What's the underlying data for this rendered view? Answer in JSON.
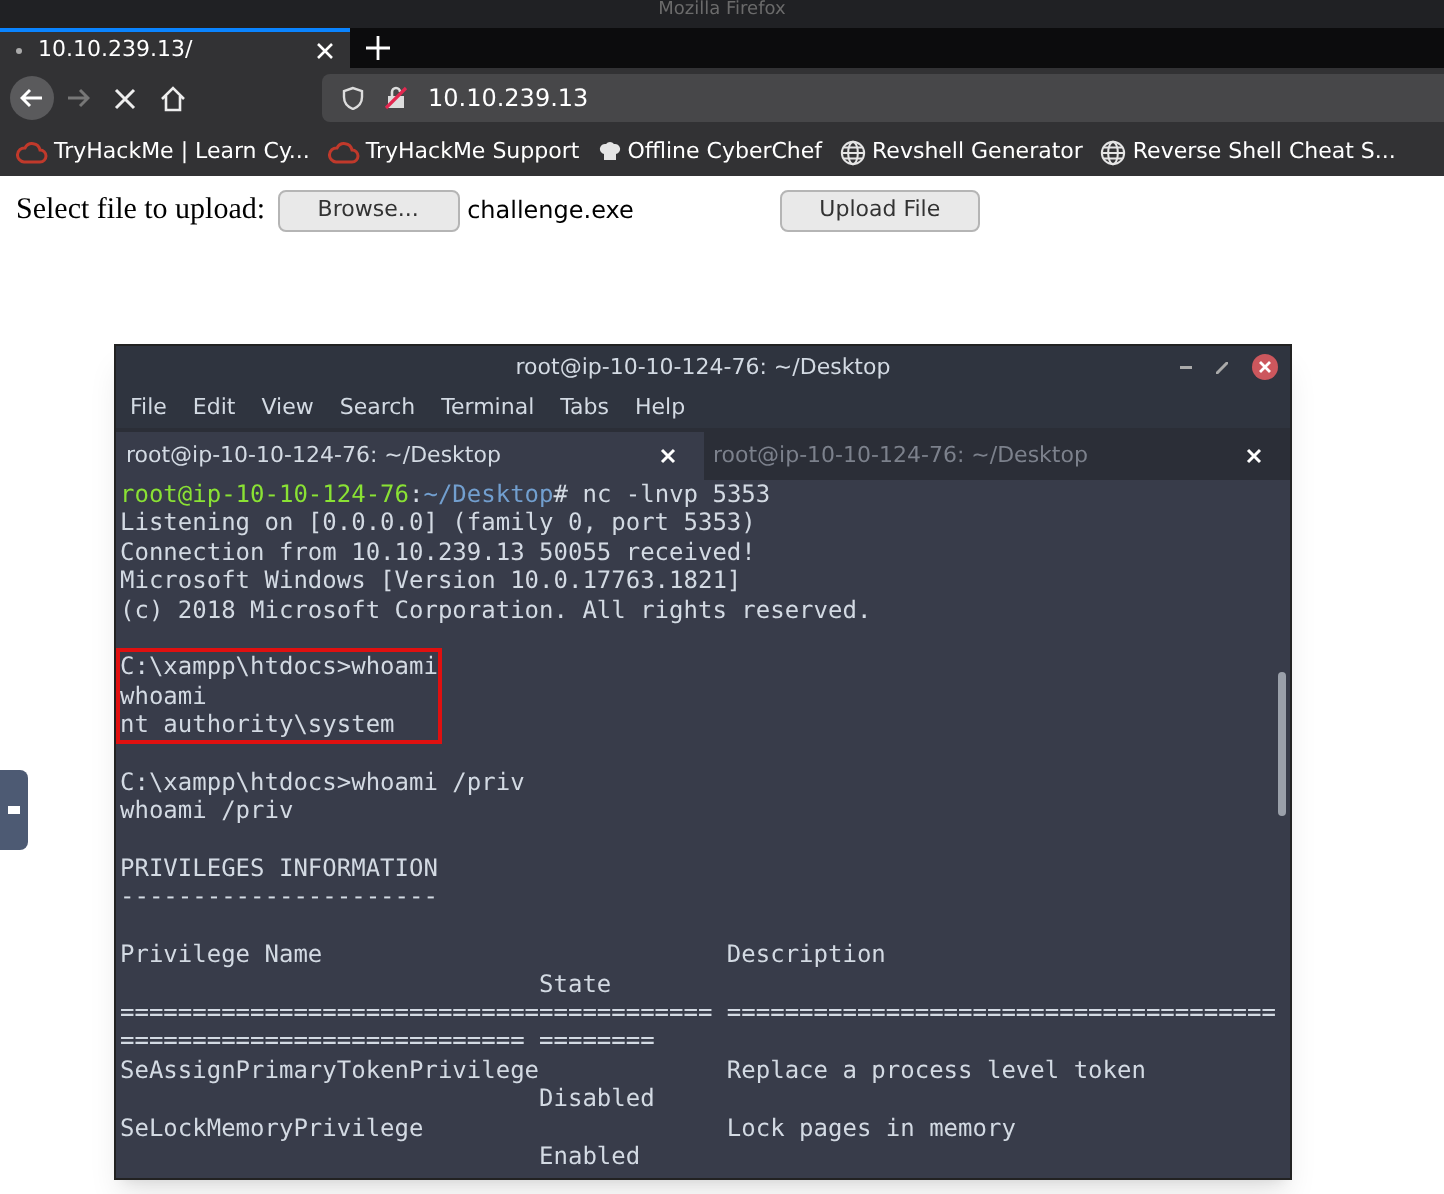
{
  "window": {
    "title": "Mozilla Firefox"
  },
  "tabs": [
    {
      "label": "10.10.239.13/",
      "selected": true,
      "loading": true
    }
  ],
  "nav": {
    "back_enabled": true,
    "forward_enabled": false,
    "url": "10.10.239.13"
  },
  "bookmarks": [
    {
      "label": "TryHackMe | Learn Cy...",
      "kind": "cloud"
    },
    {
      "label": "TryHackMe Support",
      "kind": "cloud"
    },
    {
      "label": "Offline CyberChef",
      "kind": "chef"
    },
    {
      "label": "Revshell Generator",
      "kind": "globe"
    },
    {
      "label": "Reverse Shell Cheat S...",
      "kind": "globe"
    }
  ],
  "page": {
    "label": "Select file to upload:",
    "browse_button": "Browse...",
    "file_name": "challenge.exe",
    "upload_button": "Upload File"
  },
  "terminal": {
    "title": "root@ip-10-10-124-76: ~/Desktop",
    "menu": [
      "File",
      "Edit",
      "View",
      "Search",
      "Terminal",
      "Tabs",
      "Help"
    ],
    "tabs": [
      {
        "label": "root@ip-10-10-124-76: ~/Desktop",
        "selected": true
      },
      {
        "label": "root@ip-10-10-124-76: ~/Desktop",
        "selected": false
      }
    ],
    "sections": [
      {
        "highlighted": false,
        "lines": [
          {
            "kind": "prompt",
            "user": "root@ip-10-10-124-76",
            "separator": ":",
            "path": "~/Desktop",
            "command": "# nc -lnvp 5353"
          },
          {
            "kind": "output",
            "text": "Listening on [0.0.0.0] (family 0, port 5353)"
          },
          {
            "kind": "output",
            "text": "Connection from 10.10.239.13 50055 received!"
          },
          {
            "kind": "output",
            "text": "Microsoft Windows [Version 10.0.17763.1821]"
          },
          {
            "kind": "output",
            "text": "(c) 2018 Microsoft Corporation. All rights reserved."
          },
          {
            "kind": "blank"
          }
        ]
      },
      {
        "highlighted": true,
        "lines": [
          {
            "kind": "output",
            "text": "C:\\xampp\\htdocs>whoami"
          },
          {
            "kind": "output",
            "text": "whoami"
          },
          {
            "kind": "output",
            "text": "nt authority\\system"
          }
        ]
      },
      {
        "highlighted": false,
        "lines": [
          {
            "kind": "blank"
          },
          {
            "kind": "output",
            "text": "C:\\xampp\\htdocs>whoami /priv"
          },
          {
            "kind": "output",
            "text": "whoami /priv"
          },
          {
            "kind": "blank"
          },
          {
            "kind": "output",
            "text": "PRIVILEGES INFORMATION"
          },
          {
            "kind": "output",
            "text": "----------------------"
          },
          {
            "kind": "blank"
          },
          {
            "kind": "output",
            "text": "Privilege Name                            Description"
          },
          {
            "kind": "output",
            "text": "                             State"
          },
          {
            "kind": "output",
            "text": "========================================= ======================================"
          },
          {
            "kind": "output",
            "text": "============================ ========"
          },
          {
            "kind": "output",
            "text": "SeAssignPrimaryTokenPrivilege             Replace a process level token"
          },
          {
            "kind": "output",
            "text": "                             Disabled"
          },
          {
            "kind": "output",
            "text": "SeLockMemoryPrivilege                     Lock pages in memory"
          },
          {
            "kind": "output",
            "text": "                             Enabled"
          }
        ]
      }
    ]
  }
}
